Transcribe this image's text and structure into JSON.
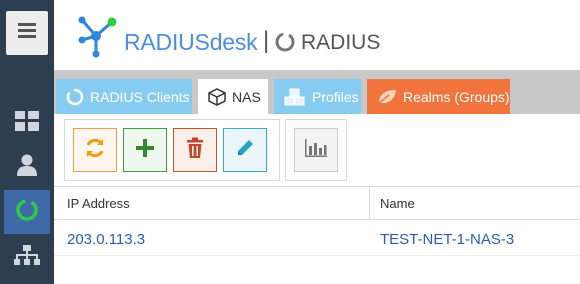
{
  "header": {
    "brand": "RADIUSdesk",
    "separator": "|",
    "section": "RADIUS"
  },
  "sidebar": {
    "items": [
      {
        "icon": "hamburger-menu-icon"
      },
      {
        "icon": "dashboard-grid-icon"
      },
      {
        "icon": "user-icon"
      },
      {
        "icon": "radius-ring-icon",
        "active": true
      },
      {
        "icon": "network-tree-icon"
      }
    ]
  },
  "tabs": [
    {
      "label": "RADIUS Clients",
      "icon": "ring-icon"
    },
    {
      "label": "NAS",
      "icon": "cube-icon",
      "active": true
    },
    {
      "label": "Profiles",
      "icon": "cubes-icon"
    },
    {
      "label": "Realms (Groups)",
      "icon": "leaf-icon"
    }
  ],
  "toolbar": {
    "buttons": [
      {
        "name": "reload",
        "icon": "reload-icon"
      },
      {
        "name": "add",
        "icon": "plus-icon"
      },
      {
        "name": "delete",
        "icon": "trash-icon"
      },
      {
        "name": "edit",
        "icon": "pencil-icon"
      },
      {
        "name": "graph",
        "icon": "bar-chart-icon"
      }
    ]
  },
  "grid": {
    "columns": [
      "IP Address",
      "Name"
    ],
    "rows": [
      {
        "ip": "203.0.113.3",
        "name": "TEST-NET-1-NAS-3"
      }
    ]
  },
  "colors": {
    "sidebar": "#2d3e50",
    "sidebar_active": "#3e6aa8",
    "tab_blue": "#87ccf0",
    "tab_orange": "#f0743c",
    "link_blue": "#2a5db0",
    "brand_blue": "#4a90e2"
  }
}
